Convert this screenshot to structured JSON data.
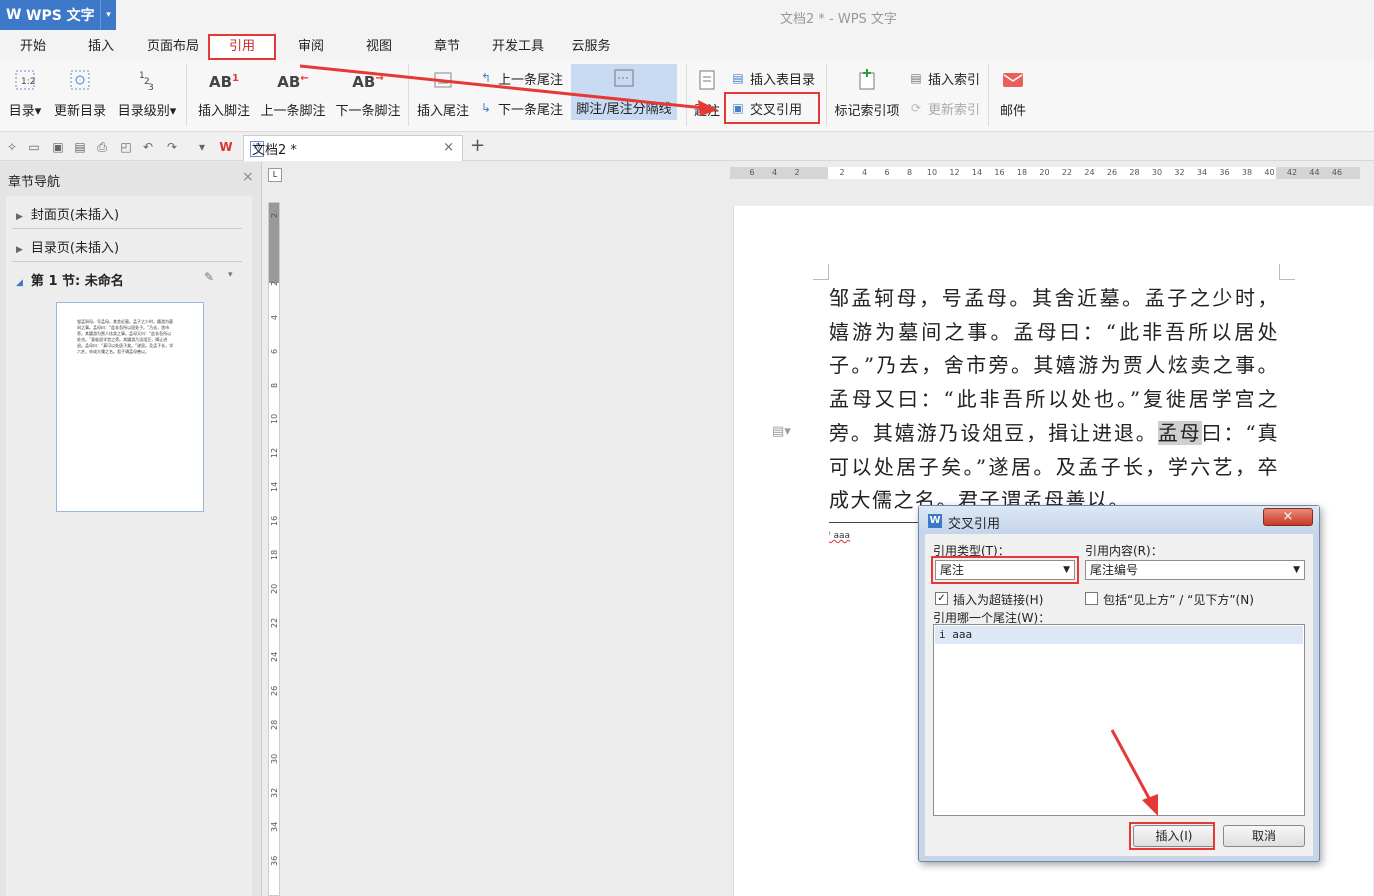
{
  "app": {
    "app_button": "WPS 文字",
    "window_title": "文档2 * - WPS 文字"
  },
  "menu": {
    "tabs": [
      "开始",
      "插入",
      "页面布局",
      "引用",
      "审阅",
      "视图",
      "章节",
      "开发工具",
      "云服务"
    ],
    "active": "引用"
  },
  "ribbon": {
    "toc": "目录",
    "update_toc": "更新目录",
    "toc_level": "目录级别",
    "insert_footnote": "插入脚注",
    "prev_footnote": "上一条脚注",
    "next_footnote": "下一条脚注",
    "insert_endnote": "插入尾注",
    "prev_endnote": "上一条尾注",
    "next_endnote": "下一条尾注",
    "separator": "脚注/尾注分隔线",
    "caption": "题注",
    "insert_table_toc": "插入表目录",
    "cross_ref": "交叉引用",
    "mark_index": "标记索引项",
    "insert_index": "插入索引",
    "update_index": "更新索引",
    "mail": "邮件"
  },
  "doc_tab": {
    "label": "文档2 *"
  },
  "nav": {
    "title": "章节导航",
    "items": [
      "封面页(未插入)",
      "目录页(未插入)",
      "第 1 节: 未命名"
    ]
  },
  "document": {
    "text_before": "邹孟轲母，号孟母。其舍近墓。孟子之少时，嬉游为墓间之事。孟母曰：“此非吾所以居处子。”乃去，舍市旁。其嬉游为贾人炫卖之事。孟母又曰：“此非吾所以处也。”复徙居学宫之旁。其嬉游乃设俎豆，揖让进退。",
    "text_selected": "孟母",
    "text_after": "曰：“真可以处居子矣。”遂居。及孟子长，学六艺，卒成大儒之名。君子谓孟母善以。",
    "footnote": "ⁱ aaa"
  },
  "dialog": {
    "title": "交叉引用",
    "ref_type_label": "引用类型(T)：",
    "ref_type_value": "尾注",
    "ref_content_label": "引用内容(R)：",
    "ref_content_value": "尾注编号",
    "hyperlink_label": "插入为超链接(H)",
    "hyperlink_checked": true,
    "above_below_label": "包括“见上方” / “见下方”(N)",
    "above_below_checked": false,
    "which_label": "引用哪一个尾注(W)：",
    "list_items": [
      "i aaa"
    ],
    "insert_button": "插入(I)",
    "cancel_button": "取消"
  },
  "ruler": {
    "h_ticks": [
      "6",
      "4",
      "2",
      "",
      "2",
      "4",
      "6",
      "8",
      "10",
      "12",
      "14",
      "16",
      "18",
      "20",
      "22",
      "24",
      "26",
      "28",
      "30",
      "32",
      "34",
      "36",
      "38",
      "40",
      "42",
      "44",
      "46"
    ],
    "v_ticks": [
      "2",
      "",
      "2",
      "4",
      "6",
      "8",
      "10",
      "12",
      "14",
      "16",
      "18",
      "20",
      "22",
      "24",
      "26",
      "28",
      "30",
      "32",
      "34",
      "36"
    ]
  },
  "colors": {
    "accent": "#3d78c9",
    "highlight": "#e53935"
  }
}
